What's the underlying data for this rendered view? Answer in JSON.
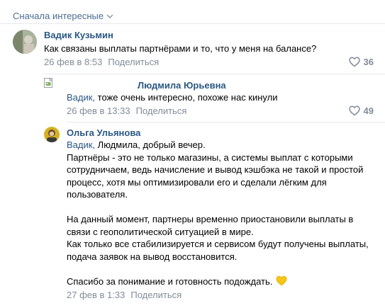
{
  "sort": {
    "label": "Сначала интересные"
  },
  "comments": [
    {
      "author": "Вадик Кузьмин",
      "lines": [
        "Как связаны выплаты партнёрами и то, что у меня на балансе?"
      ],
      "date": "26 фев в 8:53",
      "share": "Поделиться",
      "likes": "36"
    },
    {
      "author": "Людмила Юрьевна",
      "reply_to": "Вадик,",
      "lines": [
        " тоже очень интересно, похоже нас кинули"
      ],
      "date": "26 фев в 13:33",
      "share": "Поделиться",
      "likes": "49"
    },
    {
      "author": "Ольга Ульянова",
      "reply_to": "Вадик,",
      "lines": [
        " Людмила, добрый вечер.",
        "Партнёры - это не только магазины, а системы выплат с которыми",
        "сотрудничаем, ведь начисление и вывод кэшбэка не такой и простой",
        "процесс, хотя мы оптимизировали его и сделали лёгким для",
        "пользователя.",
        "",
        "На данный момент, партнеры временно приостановили выплаты в",
        "связи с геополитической ситуацией в мире.",
        "Как только все стабилизируется и сервисом будут получены выплаты,",
        "подача заявок на вывод восстановится.",
        "",
        "Спасибо за понимание и готовность подождать."
      ],
      "date": "27 фев в 1:33",
      "share": "Поделиться"
    }
  ],
  "icons": {
    "chevron": "chevron-down-icon",
    "heart": "heart-outline-icon",
    "emoji": "yellow-heart-emoji"
  },
  "colors": {
    "link": "#2a5885",
    "muted": "#818c99",
    "divider": "#e7e8ec"
  }
}
